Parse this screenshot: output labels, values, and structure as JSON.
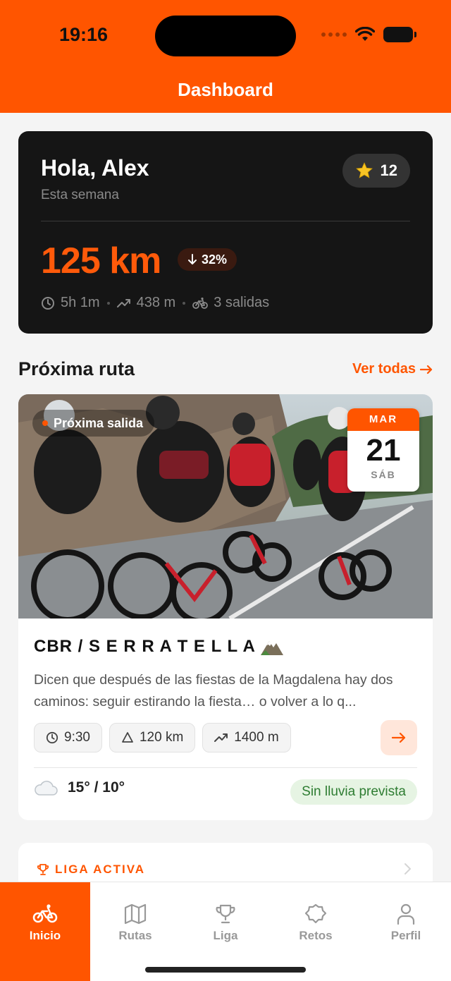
{
  "status_bar": {
    "time": "19:16"
  },
  "header": {
    "title": "Dashboard"
  },
  "summary": {
    "greeting": "Hola, Alex",
    "period": "Esta semana",
    "points": "12",
    "distance": "125 km",
    "trend": "32%",
    "trend_direction": "down",
    "stats": {
      "time": "5h 1m",
      "elevation": "438 m",
      "rides": "3 salidas"
    }
  },
  "next_route_section": {
    "title": "Próxima ruta",
    "see_all": "Ver todas"
  },
  "route": {
    "badge": "Próxima salida",
    "date": {
      "month": "MAR",
      "day": "21",
      "weekday": "SÁB"
    },
    "name": "CBR / S E R R A T E L L A",
    "name_emoji": "⛰️",
    "description": "Dicen que después de las fiestas de la Magdalena hay dos caminos: seguir estirando la fiesta… o volver a lo q...",
    "chips": {
      "time": "9:30",
      "distance": "120 km",
      "elevation": "1400 m"
    },
    "weather": {
      "icon": "cloud-icon",
      "temps": "15° / 10°",
      "rain": "Sin lluvia prevista"
    }
  },
  "league": {
    "label": "LIGA ACTIVA"
  },
  "tabs": [
    {
      "label": "Inicio",
      "icon": "bike-icon",
      "active": true
    },
    {
      "label": "Rutas",
      "icon": "map-icon",
      "active": false
    },
    {
      "label": "Liga",
      "icon": "trophy-icon",
      "active": false
    },
    {
      "label": "Retos",
      "icon": "badge-icon",
      "active": false
    },
    {
      "label": "Perfil",
      "icon": "person-icon",
      "active": false
    }
  ],
  "colors": {
    "accent": "#ff5500",
    "card_dark": "#151515",
    "success": "#2e7d32"
  }
}
